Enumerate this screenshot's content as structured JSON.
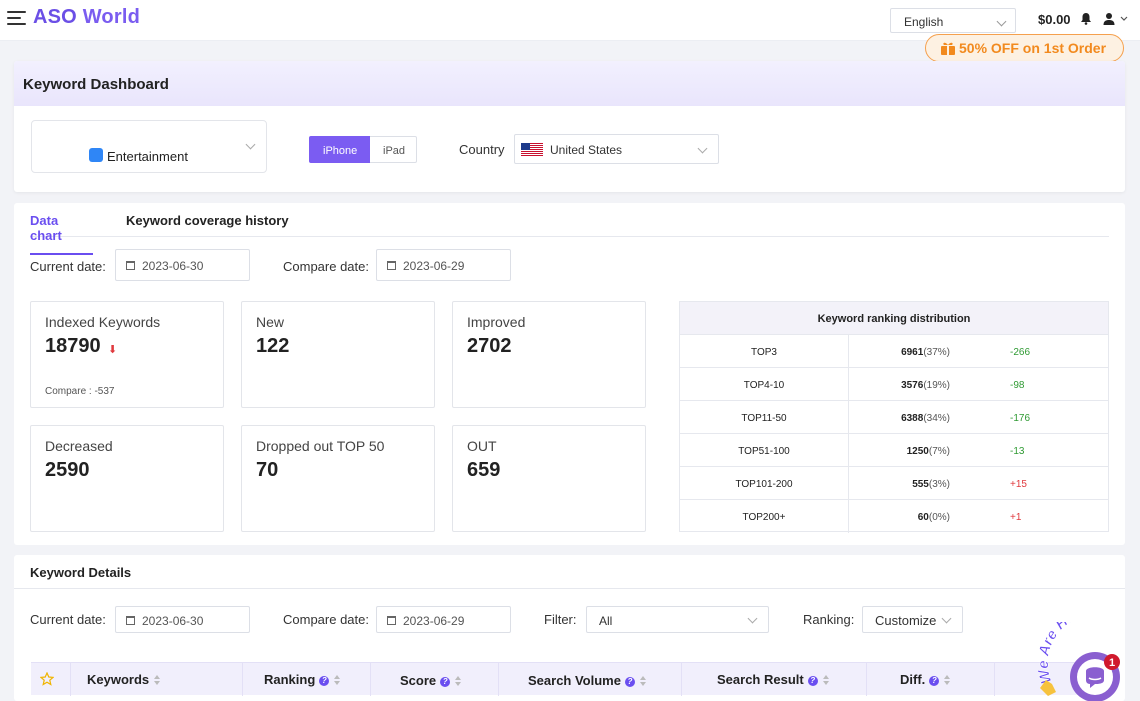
{
  "header": {
    "logo_aso": "ASO",
    "logo_world": "World",
    "language": "English",
    "balance": "$0.00",
    "promo": "50% OFF on 1st Order"
  },
  "dashboard": {
    "title": "Keyword Dashboard",
    "app_category": "Entertainment",
    "device_on": "iPhone",
    "device_off": "iPad",
    "country_label": "Country",
    "country": "United States"
  },
  "data_chart": {
    "tabs": [
      "Data chart",
      "Keyword coverage history"
    ],
    "current_date_label": "Current date:",
    "current_date": "2023-06-30",
    "compare_date_label": "Compare date:",
    "compare_date": "2023-06-29",
    "stats": [
      {
        "title": "Indexed Keywords",
        "value": "18790",
        "compare": "Compare : -537"
      },
      {
        "title": "New",
        "value": "122"
      },
      {
        "title": "Improved",
        "value": "2702"
      },
      {
        "title": "Decreased",
        "value": "2590"
      },
      {
        "title": "Dropped out TOP 50",
        "value": "70"
      },
      {
        "title": "OUT",
        "value": "659"
      }
    ],
    "distribution": {
      "title": "Keyword ranking distribution",
      "rows": [
        {
          "range": "TOP3",
          "count": "6961",
          "pct": "(37%)",
          "diff": "-266",
          "diff_color": "#2f9a33"
        },
        {
          "range": "TOP4-10",
          "count": "3576",
          "pct": "(19%)",
          "diff": "-98",
          "diff_color": "#2f9a33"
        },
        {
          "range": "TOP11-50",
          "count": "6388",
          "pct": "(34%)",
          "diff": "-176",
          "diff_color": "#2f9a33"
        },
        {
          "range": "TOP51-100",
          "count": "1250",
          "pct": "(7%)",
          "diff": "-13",
          "diff_color": "#2f9a33"
        },
        {
          "range": "TOP101-200",
          "count": "555",
          "pct": "(3%)",
          "diff": "+15",
          "diff_color": "#e0393e"
        },
        {
          "range": "TOP200+",
          "count": "60",
          "pct": "(0%)",
          "diff": "+1",
          "diff_color": "#e0393e"
        }
      ]
    }
  },
  "keyword_details": {
    "title": "Keyword Details",
    "current_date_label": "Current date:",
    "current_date": "2023-06-30",
    "compare_date_label": "Compare date:",
    "compare_date": "2023-06-29",
    "filter_label": "Filter:",
    "filter_value": "All",
    "ranking_label": "Ranking:",
    "ranking_value": "Customize",
    "columns": [
      "Keywords",
      "Ranking",
      "Score",
      "Search Volume",
      "Search Result",
      "Diff."
    ]
  },
  "chat": {
    "badge": "1",
    "text": "We Are Here!"
  },
  "colors": {
    "accent": "#6a4ef0",
    "promo": "#f28a1e",
    "down": "#e0393e",
    "up": "#2f9a33"
  }
}
